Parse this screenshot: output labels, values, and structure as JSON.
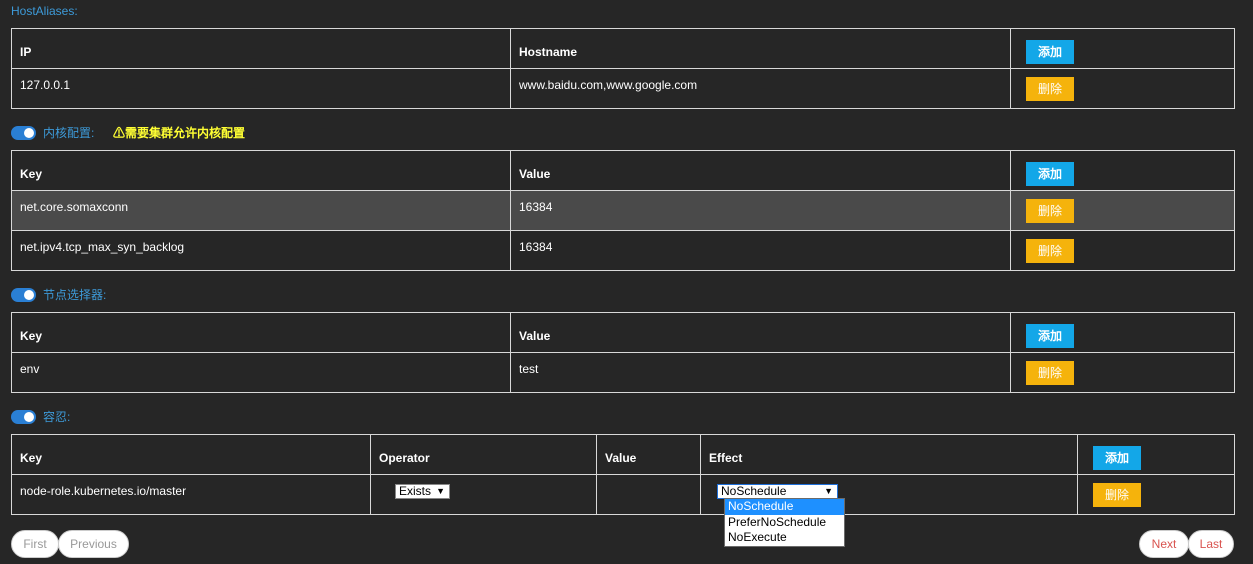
{
  "host_aliases": {
    "label": "HostAliases:",
    "headers": [
      "IP",
      "Hostname"
    ],
    "add_label": "添加",
    "rows": [
      {
        "ip": "127.0.0.1",
        "hostname": "www.baidu.com,www.google.com",
        "delete_label": "删除"
      }
    ]
  },
  "kernel": {
    "label": "内核配置:",
    "warning": "⚠需要集群允许内核配置",
    "headers": [
      "Key",
      "Value"
    ],
    "add_label": "添加",
    "rows": [
      {
        "key": "net.core.somaxconn",
        "value": "16384",
        "delete_label": "删除"
      },
      {
        "key": "net.ipv4.tcp_max_syn_backlog",
        "value": "16384",
        "delete_label": "删除"
      }
    ]
  },
  "node_selector": {
    "label": "节点选择器:",
    "headers": [
      "Key",
      "Value"
    ],
    "add_label": "添加",
    "rows": [
      {
        "key": "env",
        "value": "test",
        "delete_label": "删除"
      }
    ]
  },
  "tolerations": {
    "label": "容忍:",
    "headers": [
      "Key",
      "Operator",
      "Value",
      "Effect"
    ],
    "add_label": "添加",
    "rows": [
      {
        "key": "node-role.kubernetes.io/master",
        "operator": "Exists",
        "value": "",
        "effect": "NoSchedule",
        "delete_label": "删除"
      }
    ],
    "effect_options": [
      "NoSchedule",
      "PreferNoSchedule",
      "NoExecute"
    ]
  },
  "pagination": {
    "first": "First",
    "previous": "Previous",
    "next": "Next",
    "last": "Last"
  },
  "colors": {
    "background": "#262626",
    "accent_label": "#3d9ad8",
    "add_button": "#13a7e8",
    "delete_button": "#f5b30c",
    "warning": "#ffff33"
  }
}
